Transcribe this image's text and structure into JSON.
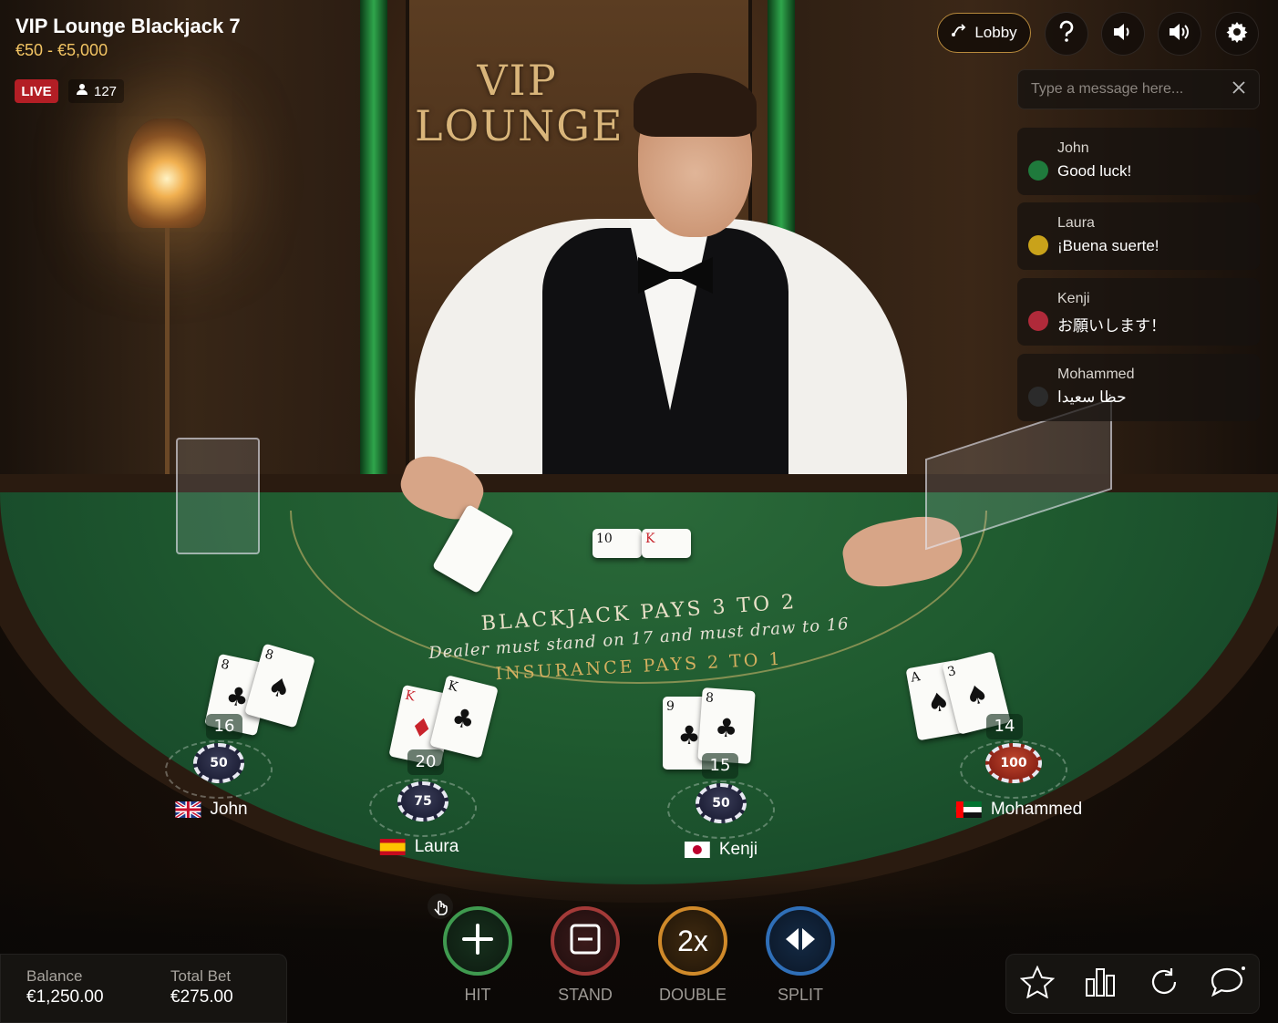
{
  "header": {
    "table_title": "VIP Lounge Blackjack 7",
    "limits": "€50 - €5,000",
    "live_label": "LIVE",
    "viewer_count": "127"
  },
  "scene": {
    "sign_line1": "VIP",
    "sign_line2": "LOUNGE"
  },
  "top_controls": {
    "lobby_label": "Lobby",
    "help_icon": "help-icon",
    "sound_icons": [
      "volume-low-icon",
      "volume-high-icon"
    ],
    "settings_icon": "gear-icon"
  },
  "chat": {
    "placeholder": "Type a message here...",
    "messages": [
      {
        "user": "John",
        "text": "Good luck!"
      },
      {
        "user": "Laura",
        "text": "¡Buena suerte!"
      },
      {
        "user": "Kenji",
        "text": "お願いします！"
      },
      {
        "user": "Mohammed",
        "text": "حظا سعيدا"
      }
    ]
  },
  "table": {
    "main_text": "BLACKJACK PAYS 3 TO 2",
    "rule_text": "Dealer must stand on 17 and must draw to 16",
    "insurance_text": "INSURANCE PAYS 2 TO 1",
    "dealer_cards": [
      "10",
      "K"
    ]
  },
  "players": [
    {
      "name": "John",
      "score": "16",
      "bet": "50",
      "cards": [
        "8",
        "8"
      ],
      "flag": "uk"
    },
    {
      "name": "Laura",
      "score": "20",
      "bet": "75",
      "cards": [
        "K",
        "K"
      ],
      "flag": "es"
    },
    {
      "name": "Kenji",
      "score": "15",
      "bet": "50",
      "cards": [
        "9",
        "8"
      ],
      "flag": "jp"
    },
    {
      "name": "Mohammed",
      "score": "14",
      "bet": "100",
      "cards": [
        "A",
        "3"
      ],
      "flag": "ae"
    }
  ],
  "bottom": {
    "balance_label": "Balance",
    "balance_value": "€1,250.00",
    "total_bet_label": "Total Bet",
    "total_bet_value": "€275.00",
    "actions": [
      {
        "label": "HIT",
        "icon": "plus-icon",
        "color": "#3f9a4f"
      },
      {
        "label": "STAND",
        "icon": "minus-square-icon",
        "color": "#a33a38"
      },
      {
        "label": "DOUBLE",
        "icon_text": "2x",
        "color": "#d08a2a"
      },
      {
        "label": "SPLIT",
        "icon": "split-arrows-icon",
        "color": "#2f6fb8"
      }
    ],
    "tools": [
      "star-icon",
      "stats-icon",
      "refresh-icon",
      "chat-icon"
    ]
  }
}
